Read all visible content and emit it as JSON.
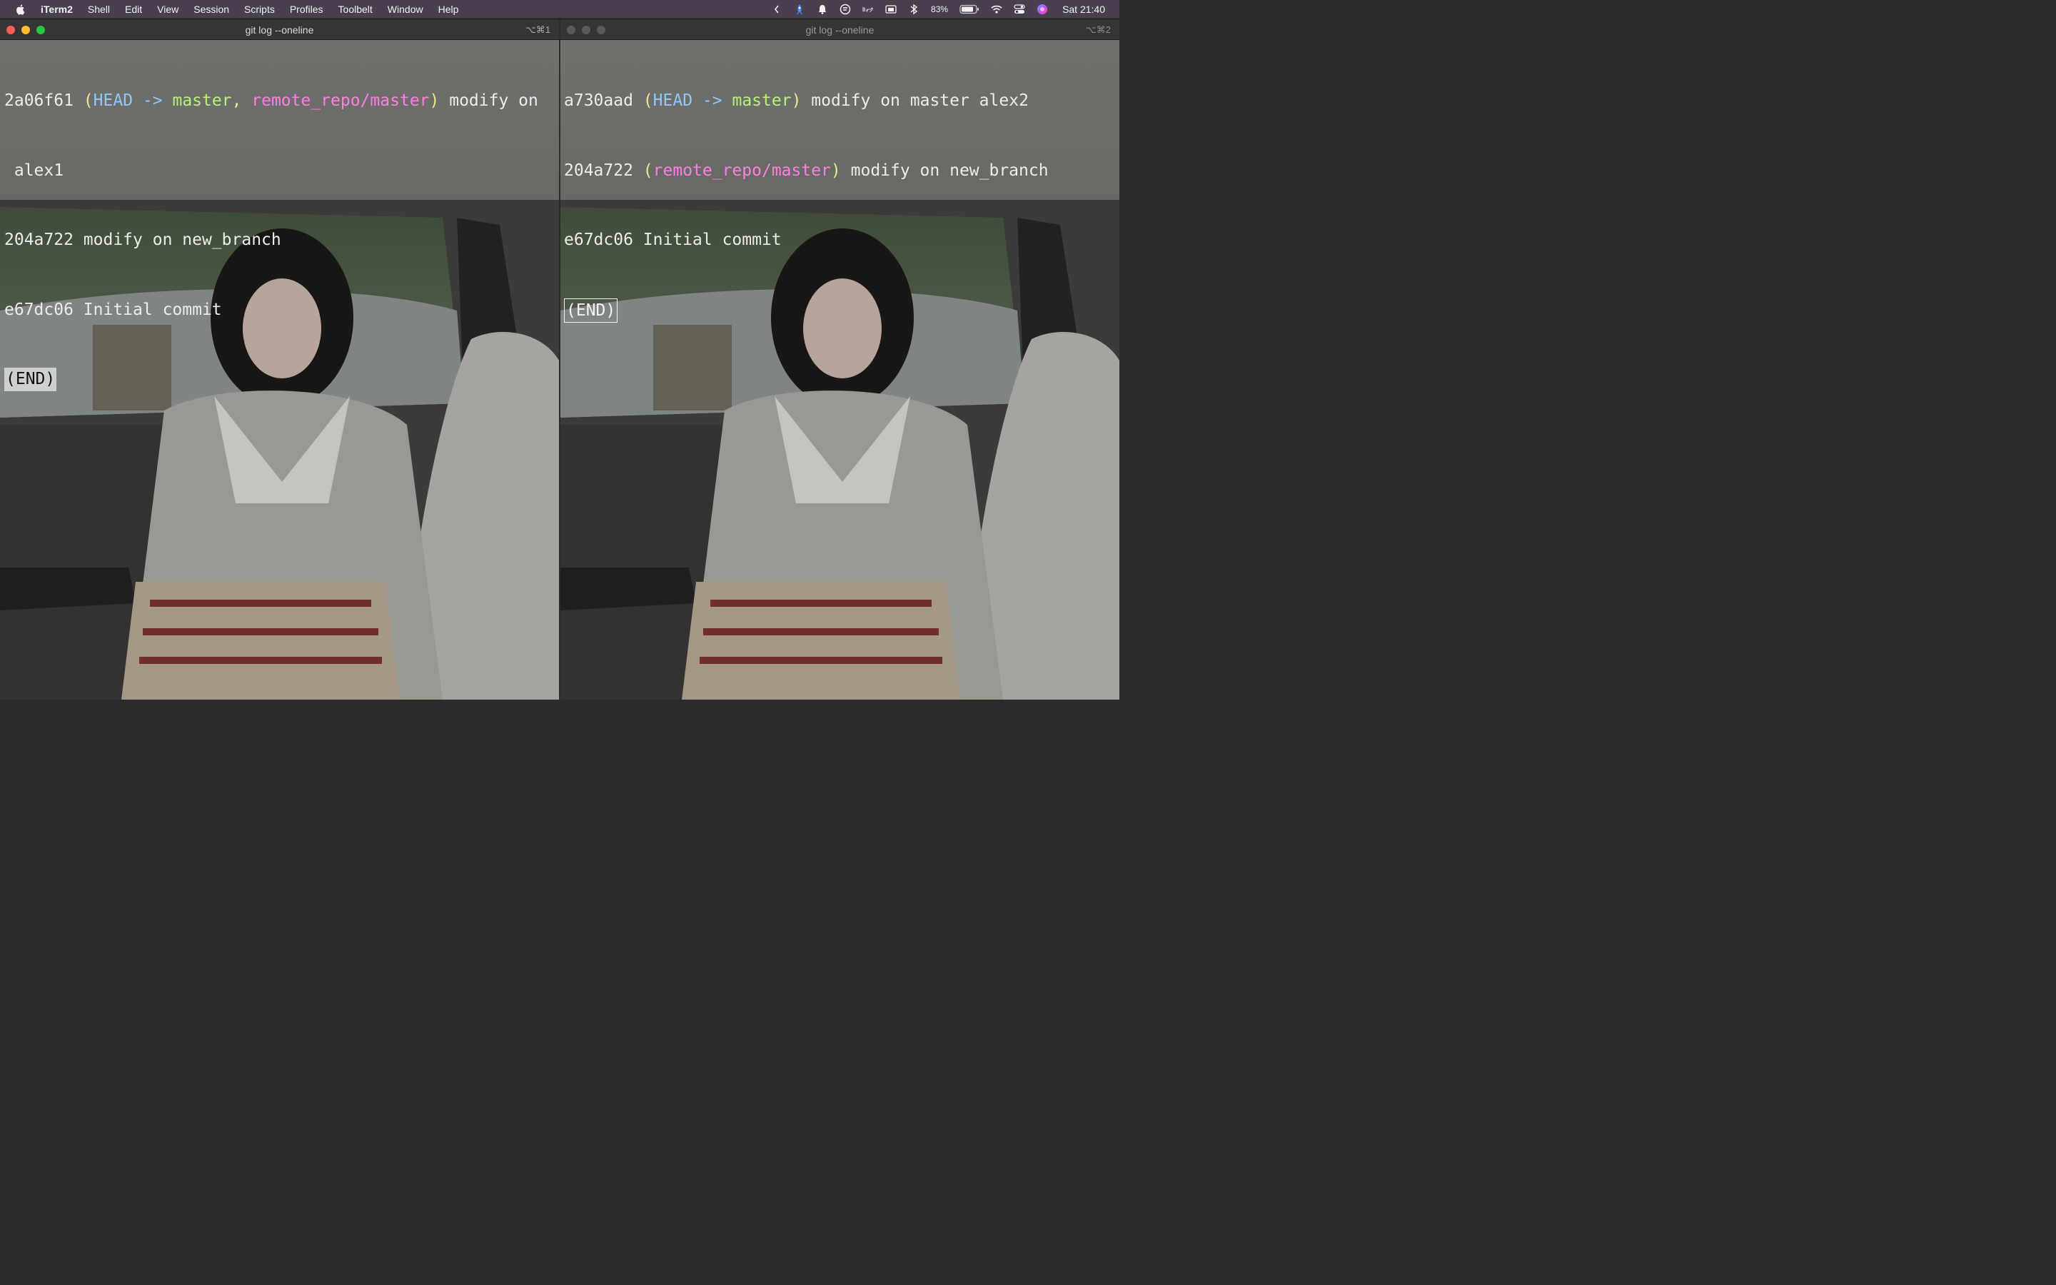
{
  "menubar": {
    "app_name": "iTerm2",
    "items": [
      "Shell",
      "Edit",
      "View",
      "Session",
      "Scripts",
      "Profiles",
      "Toolbelt",
      "Window",
      "Help"
    ],
    "battery_percent": "83%",
    "clock": "Sat 21:40"
  },
  "windows": [
    {
      "title": "git log --oneline",
      "shortcut": "⌥⌘1",
      "lines": {
        "l1_hash": "2a06f61",
        "l1_head": "HEAD",
        "l1_arrow": "->",
        "l1_branch": "master",
        "l1_remote": "remote_repo/master",
        "l1_msg": "modify on",
        "l1_wrap": "alex1",
        "l2_hash": "204a722",
        "l2_msg": "modify on new_branch",
        "l3_hash": "e67dc06",
        "l3_msg": "Initial commit",
        "end": "(END)"
      }
    },
    {
      "title": "git log --oneline",
      "shortcut": "⌥⌘2",
      "lines": {
        "l1_hash": "a730aad",
        "l1_head": "HEAD",
        "l1_arrow": "->",
        "l1_branch": "master",
        "l1_msg": "modify on master alex2",
        "l2_hash": "204a722",
        "l2_remote": "remote_repo/master",
        "l2_msg": "modify on new_branch",
        "l3_hash": "e67dc06",
        "l3_msg": "Initial commit",
        "end": "(END)"
      }
    }
  ],
  "colors": {
    "head": "#8fc7ff",
    "branch": "#b6f27a",
    "remote": "#ff7ee6",
    "close": "#ff5f57",
    "minimize": "#febc2e",
    "zoom": "#28c840"
  }
}
